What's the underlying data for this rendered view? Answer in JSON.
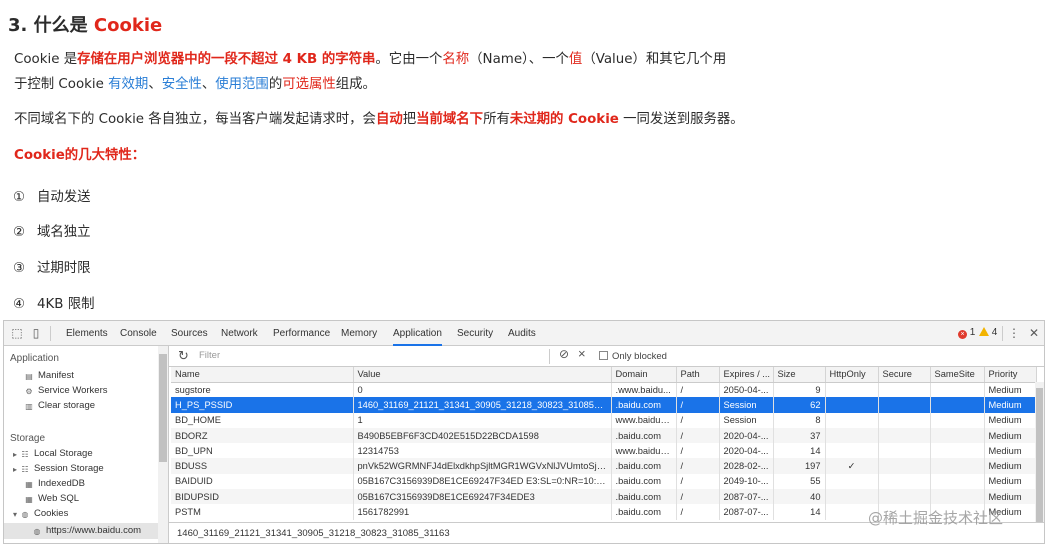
{
  "article": {
    "heading_prefix": "3. 什么是 ",
    "heading_keyword": "Cookie",
    "para1": {
      "a": "Cookie 是",
      "b": "存储在用户浏览器中的一段不超过 4 KB 的字符串",
      "c": "。它由一个",
      "d": "名称",
      "e": "（Name）、一个",
      "f": "值",
      "g": "（Value）和其它几个用"
    },
    "para2": {
      "a": "于控制 Cookie ",
      "b": "有效期",
      "c": "、",
      "d": "安全性",
      "e": "、",
      "f": "使用范围",
      "g": "的",
      "h": "可选属性",
      "i": "组成。"
    },
    "para3": {
      "a": "不同域名下的 Cookie 各自独立，每当客户端发起请求时，会",
      "b": "自动",
      "c": "把",
      "d": "当前域名下",
      "e": "所有",
      "f": "未过期的 Cookie",
      "g": " 一同发送到服务器。"
    },
    "features_title": "Cookie的几大特性：",
    "features": [
      {
        "num": "①",
        "text": "自动发送"
      },
      {
        "num": "②",
        "text": "域名独立"
      },
      {
        "num": "③",
        "text": "过期时限"
      },
      {
        "num": "④",
        "text": "4KB 限制"
      }
    ]
  },
  "devtools": {
    "tabs": [
      "Elements",
      "Console",
      "Sources",
      "Network",
      "Performance",
      "Memory",
      "Application",
      "Security",
      "Audits"
    ],
    "active_tab": "Application",
    "error_count": "1",
    "warning_count": "4",
    "sidebar": {
      "application_title": "Application",
      "application_items": [
        "Manifest",
        "Service Workers",
        "Clear storage"
      ],
      "storage_title": "Storage",
      "storage_items": [
        "Local Storage",
        "Session Storage",
        "IndexedDB",
        "Web SQL",
        "Cookies"
      ],
      "cookie_origin": "https://www.baidu.com"
    },
    "toolbar": {
      "filter_placeholder": "Filter",
      "only_blocked": "Only blocked"
    },
    "columns": [
      "Name",
      "Value",
      "Domain",
      "Path",
      "Expires / ...",
      "Size",
      "HttpOnly",
      "Secure",
      "SameSite",
      "Priority"
    ],
    "rows": [
      {
        "name": "sugstore",
        "value": "0",
        "domain": ".www.baidu...",
        "path": "/",
        "expires": "2050-04-...",
        "size": "9",
        "httponly": "",
        "secure": "",
        "samesite": "",
        "priority": "Medium"
      },
      {
        "name": "H_PS_PSSID",
        "value": "1460_31169_21121_31341_30905_31218_30823_31085_31163",
        "domain": ".baidu.com",
        "path": "/",
        "expires": "Session",
        "size": "62",
        "httponly": "",
        "secure": "",
        "samesite": "",
        "priority": "Medium"
      },
      {
        "name": "BD_HOME",
        "value": "1",
        "domain": "www.baidu.c...",
        "path": "/",
        "expires": "Session",
        "size": "8",
        "httponly": "",
        "secure": "",
        "samesite": "",
        "priority": "Medium"
      },
      {
        "name": "BDORZ",
        "value": "B490B5EBF6F3CD402E515D22BCDA1598",
        "domain": ".baidu.com",
        "path": "/",
        "expires": "2020-04-...",
        "size": "37",
        "httponly": "",
        "secure": "",
        "samesite": "",
        "priority": "Medium"
      },
      {
        "name": "BD_UPN",
        "value": "12314753",
        "domain": "www.baidu.c...",
        "path": "/",
        "expires": "2020-04-...",
        "size": "14",
        "httponly": "",
        "secure": "",
        "samesite": "",
        "priority": "Medium"
      },
      {
        "name": "BDUSS",
        "value": "pnVk52WGRMNFJ4dElxdkhpSjltMGR1WGVxNlJVUmtoSjJTE...",
        "domain": ".baidu.com",
        "path": "/",
        "expires": "2028-02-...",
        "size": "197",
        "httponly": "✓",
        "secure": "",
        "samesite": "",
        "priority": "Medium"
      },
      {
        "name": "BAIDUID",
        "value": "05B167C3156939D8E1CE69247F34ED E3:SL=0:NR=10:FG=1",
        "domain": ".baidu.com",
        "path": "/",
        "expires": "2049-10-...",
        "size": "55",
        "httponly": "",
        "secure": "",
        "samesite": "",
        "priority": "Medium"
      },
      {
        "name": "BIDUPSID",
        "value": "05B167C3156939D8E1CE69247F34EDE3",
        "domain": ".baidu.com",
        "path": "/",
        "expires": "2087-07-...",
        "size": "40",
        "httponly": "",
        "secure": "",
        "samesite": "",
        "priority": "Medium"
      },
      {
        "name": "PSTM",
        "value": "1561782991",
        "domain": ".baidu.com",
        "path": "/",
        "expires": "2087-07-...",
        "size": "14",
        "httponly": "",
        "secure": "",
        "samesite": "",
        "priority": "Medium"
      }
    ],
    "selected_value": "1460_31169_21121_31341_30905_31218_30823_31085_31163"
  },
  "watermark": "@稀土掘金技术社区",
  "colors": {
    "red": "#e0271b",
    "blue": "#2a7ed6",
    "selection": "#1a73e8"
  }
}
